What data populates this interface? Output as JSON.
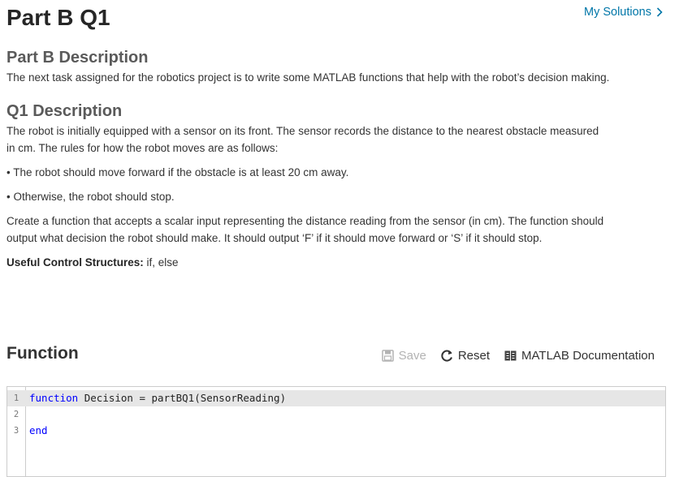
{
  "page": {
    "title": "Part B Q1",
    "my_solutions_label": "My Solutions"
  },
  "part_description": {
    "heading": "Part B Description",
    "text": "The next task assigned for the robotics project is to write some MATLAB functions that help with the robot’s decision making."
  },
  "q1_description": {
    "heading": "Q1 Description",
    "intro_line1": "The robot is initially equipped with a sensor on its front. The sensor records the distance to the nearest obstacle measured",
    "intro_line2": "in cm. The rules for how the robot moves are as follows:",
    "rule_1": "• The robot should move forward if the obstacle is at least 20 cm away.",
    "rule_2": "• Otherwise, the robot should stop.",
    "task_line1": "Create a function that accepts a scalar input representing the distance reading from the sensor (in cm). The function should",
    "task_line2": "output what decision the robot should make. It should output ‘F’ if it should move forward or ‘S’ if it should stop.",
    "useful_label": "Useful Control Structures:",
    "useful_value": " if, else"
  },
  "function_section": {
    "heading": "Function",
    "save_label": "Save",
    "reset_label": "Reset",
    "docs_label": "MATLAB Documentation"
  },
  "editor": {
    "lines": [
      {
        "number": "1",
        "keyword": "function",
        "rest": " Decision = partBQ1(SensorReading)"
      },
      {
        "number": "2",
        "keyword": "",
        "rest": ""
      },
      {
        "number": "3",
        "keyword": "end",
        "rest": ""
      }
    ]
  },
  "colors": {
    "link": "#0076a8",
    "keyword": "#0000ff",
    "active_line": "#e6e6e6"
  }
}
